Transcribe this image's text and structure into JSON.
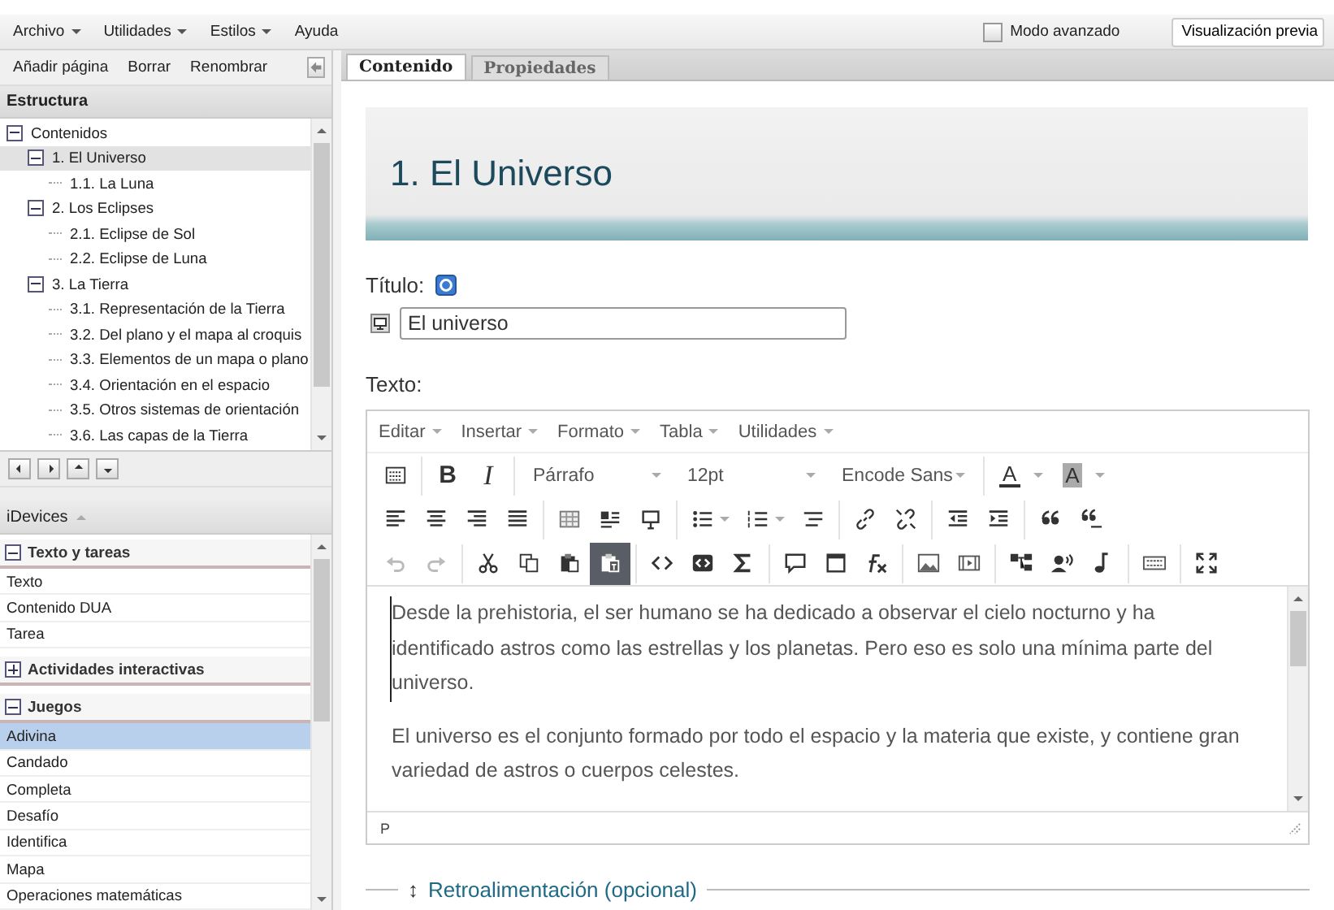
{
  "menu": [
    {
      "label": "Archivo",
      "dropdown": true
    },
    {
      "label": "Utilidades",
      "dropdown": true
    },
    {
      "label": "Estilos",
      "dropdown": true
    },
    {
      "label": "Ayuda",
      "dropdown": false
    }
  ],
  "advanced_mode": {
    "label": "Modo avanzado",
    "checked": false
  },
  "preview_button": "Visualización previa",
  "structure": {
    "actions": [
      "Añadir página",
      "Borrar",
      "Renombrar"
    ],
    "title": "Estructura",
    "tree": [
      {
        "label": "Contenidos",
        "expanded": true,
        "selected": false,
        "children": [
          {
            "label": "1. El Universo",
            "expanded": true,
            "selected": true,
            "children": [
              {
                "label": "1.1. La Luna",
                "selected": false
              }
            ]
          },
          {
            "label": "2. Los Eclipses",
            "expanded": true,
            "selected": false,
            "children": [
              {
                "label": "2.1. Eclipse de Sol",
                "selected": false
              },
              {
                "label": "2.2. Eclipse de Luna",
                "selected": false
              }
            ]
          },
          {
            "label": "3. La Tierra",
            "expanded": true,
            "selected": false,
            "children": [
              {
                "label": "3.1. Representación de la Tierra",
                "selected": false
              },
              {
                "label": "3.2. Del plano y el mapa al croquis",
                "selected": false
              },
              {
                "label": "3.3. Elementos de un mapa o plano",
                "selected": false
              },
              {
                "label": "3.4. Orientación en el espacio",
                "selected": false
              },
              {
                "label": "3.5. Otros sistemas de orientación",
                "selected": false
              },
              {
                "label": "3.6. Las capas de la Tierra",
                "selected": false
              }
            ]
          }
        ]
      }
    ]
  },
  "idevices": {
    "title": "iDevices",
    "groups": [
      {
        "label": "Texto y tareas",
        "expanded": true,
        "items": [
          {
            "label": "Texto",
            "selected": false
          },
          {
            "label": "Contenido DUA",
            "selected": false
          },
          {
            "label": "Tarea",
            "selected": false
          }
        ]
      },
      {
        "label": "Actividades interactivas",
        "expanded": false
      },
      {
        "label": "Juegos",
        "expanded": true,
        "items": [
          {
            "label": "Adivina",
            "selected": true
          },
          {
            "label": "Candado",
            "selected": false
          },
          {
            "label": "Completa",
            "selected": false
          },
          {
            "label": "Desafío",
            "selected": false
          },
          {
            "label": "Identifica",
            "selected": false
          },
          {
            "label": "Mapa",
            "selected": false
          },
          {
            "label": "Operaciones matemáticas",
            "selected": false
          }
        ]
      }
    ]
  },
  "tabs": [
    {
      "label": "Contenido",
      "selected": true
    },
    {
      "label": "Propiedades",
      "selected": false
    }
  ],
  "page_heading": "1. El Universo",
  "editor": {
    "title_label": "Título:",
    "title_value": "El universo",
    "text_label": "Texto:",
    "menus": [
      "Editar",
      "Insertar",
      "Formato",
      "Tabla",
      "Utilidades"
    ],
    "bold": "B",
    "italic": "I",
    "block_format": "Párrafo",
    "font_size": "12pt",
    "font_family": "Encode Sans",
    "text_color": "A",
    "background_color": "A",
    "undo_disabled": true,
    "redo_disabled": true,
    "paste_as_text_on": true,
    "paragraphs": [
      "Desde la prehistoria, el ser humano se ha dedicado a observar el cielo nocturno y ha identificado astros como las estrellas y los planetas. Pero eso es solo una mínima parte del universo.",
      "El universo es el conjunto formado por todo el espacio y la materia que existe, y contiene gran variedad de astros o cuerpos celestes."
    ],
    "path": "P"
  },
  "feedback": {
    "icon": "↕",
    "label": "Retroalimentación (opcional)"
  }
}
